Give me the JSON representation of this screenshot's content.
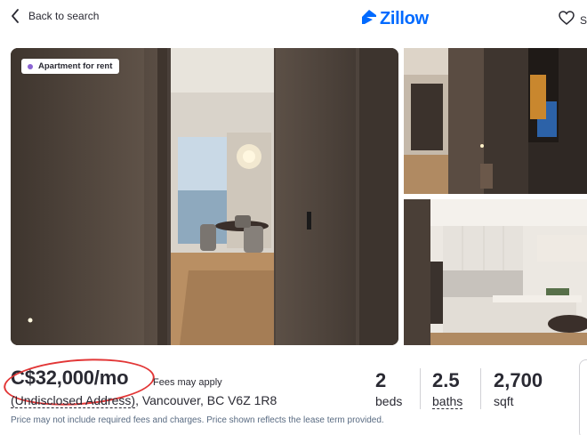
{
  "header": {
    "back_label": "Back to search",
    "logo_text": "Zillow",
    "save_label": "S"
  },
  "gallery": {
    "badge_label": "Apartment for rent",
    "photos": [
      "living-room-hallway",
      "entry-hallway",
      "kitchen"
    ]
  },
  "listing": {
    "price": "C$32,000/mo",
    "fees_note": "Fees may apply",
    "address_link": "(Undisclosed Address)",
    "address_rest": ", Vancouver, BC V6Z 1R8",
    "disclaimer": "Price may not include required fees and charges. Price shown reflects the lease term provided.",
    "stats": [
      {
        "value": "2",
        "label": "beds"
      },
      {
        "value": "2.5",
        "label": "baths"
      },
      {
        "value": "2,700",
        "label": "sqft"
      }
    ]
  },
  "colors": {
    "brand": "#006aff",
    "badge_dot": "#8a63d2",
    "annotation_circle": "#e23636",
    "text": "#2a2a33"
  }
}
